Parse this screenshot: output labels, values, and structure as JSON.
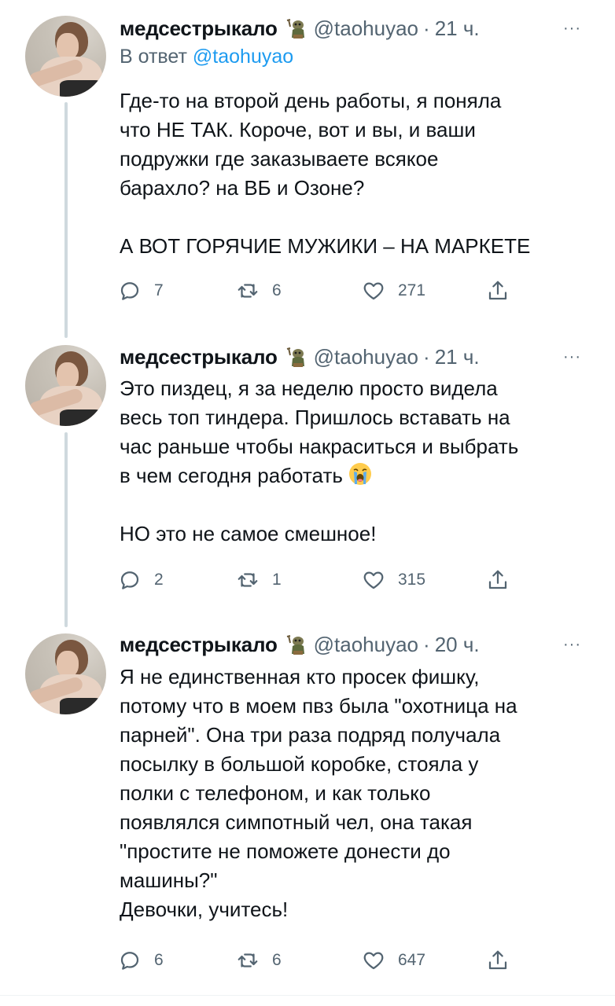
{
  "colors": {
    "accent": "#1d9bf0",
    "secondary_text": "#536471",
    "thread_line": "#cfd9de"
  },
  "tweets": [
    {
      "author": {
        "name": "медсестрыкало",
        "badge_icon": "troll-icon",
        "handle": "@taohuyao"
      },
      "separator": "·",
      "time": "21 ч.",
      "more_label": "···",
      "reply_prefix": "В ответ",
      "reply_mention": "@taohuyao",
      "text_lines": [
        "Где-то на второй день работы, я поняла",
        "что НЕ ТАК. Короче, вот и вы, и ваши",
        "подружки где заказываете всякое",
        "барахло? на ВБ и Озоне?",
        "",
        "А ВОТ ГОРЯЧИЕ МУЖИКИ – НА МАРКЕТЕ"
      ],
      "replies": "7",
      "retweets": "6",
      "likes": "271"
    },
    {
      "author": {
        "name": "медсестрыкало",
        "badge_icon": "troll-icon",
        "handle": "@taohuyao"
      },
      "separator": "·",
      "time": "21 ч.",
      "more_label": "···",
      "text_lines": [
        "Это пиздец, я за неделю просто видела",
        "весь топ тиндера. Пришлось вставать на",
        "час раньше чтобы накраситься и выбрать",
        "в чем сегодня работать",
        "",
        "НО это не самое смешное!"
      ],
      "emoji": "loudly-crying-face-emoji",
      "replies": "2",
      "retweets": "1",
      "likes": "315"
    },
    {
      "author": {
        "name": "медсестрыкало",
        "badge_icon": "troll-icon",
        "handle": "@taohuyao"
      },
      "separator": "·",
      "time": "20 ч.",
      "more_label": "···",
      "text_lines": [
        "Я не единственная кто просек фишку,",
        "потому что в моем пвз была \"охотница на",
        "парней\". Она три раза подряд получала",
        "посылку в большой коробке, стояла у",
        "полки с телефоном, и как только",
        "появлялся симпотный чел, она такая",
        "\"простите не поможете донести до",
        "машины?\"",
        "Девочки, учитесь!"
      ],
      "replies": "6",
      "retweets": "6",
      "likes": "647"
    }
  ]
}
